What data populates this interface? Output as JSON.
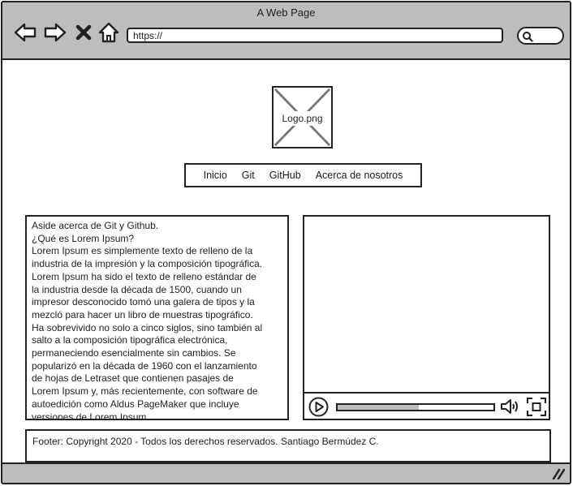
{
  "window": {
    "title": "A Web Page"
  },
  "browser": {
    "back_icon": "arrow-left-icon",
    "forward_icon": "arrow-right-icon",
    "close_icon": "x-icon",
    "home_icon": "home-icon",
    "address": "https://",
    "search_icon": "magnifier-icon"
  },
  "logo": {
    "label": "Logo.png"
  },
  "menu": {
    "items": [
      "Inicio",
      "Git",
      "GitHub",
      "Acerca de nosotros"
    ]
  },
  "aside": {
    "lines": [
      "Aside acerca de Git y Github.",
      "¿Qué es Lorem Ipsum?",
      "Lorem Ipsum es simplemente texto de relleno de la",
      "industria de la impresión y la composición tipográfica.",
      "Lorem Ipsum ha sido el texto de relleno estándar de",
      "la industria desde la década de 1500, cuando un",
      "impresor desconocido tomó una galera de tipos y la",
      "mezcló para hacer un libro de muestras tipográfico.",
      "Ha sobrevivido no solo a cinco siglos, sino también al",
      "salto a la composición tipográfica electrónica,",
      "permaneciendo esencialmente sin cambios. Se",
      "popularizó en la década de 1960 con el lanzamiento",
      "de hojas de Letraset que contienen pasajes de",
      "Lorem Ipsum y, más recientemente, con software de",
      "autoedición como Aldus PageMaker que incluye",
      "versiones de Lorem Ipsum."
    ]
  },
  "video": {
    "progress": 0.52,
    "play_icon": "play-icon",
    "volume_icon": "volume-icon",
    "fullscreen_icon": "fullscreen-icon"
  },
  "footer": {
    "text": "Footer: Copyright 2020 - Todos los derechos reservados. Santiago Bermúdez C."
  },
  "colors": {
    "chrome": "#bdbdbd",
    "stroke": "#222222",
    "background": "#ffffff"
  }
}
